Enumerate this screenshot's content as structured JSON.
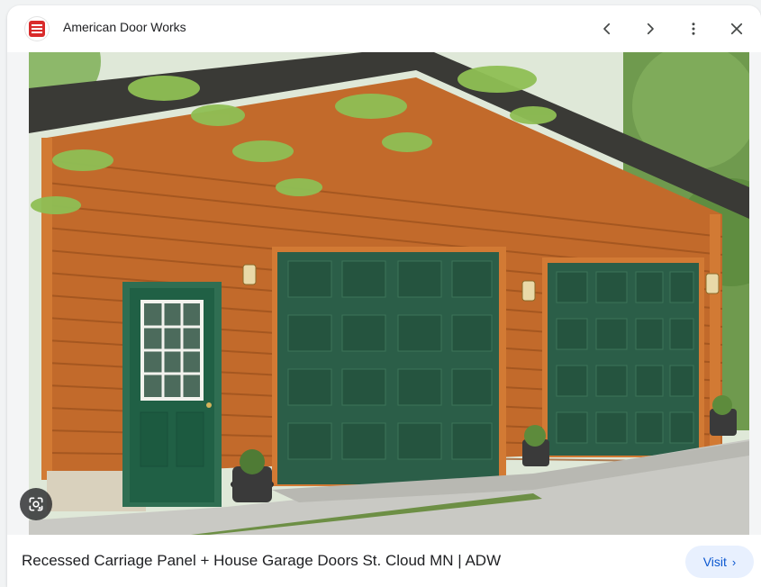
{
  "header": {
    "site_name": "American Door Works",
    "buttons": {
      "prev": "chevron-left-icon",
      "next": "chevron-right-icon",
      "more": "more-vert-icon",
      "close": "close-icon"
    }
  },
  "image": {
    "description_icon": "google-lens-icon"
  },
  "footer": {
    "caption": "Recessed Carriage Panel + House Garage Doors St. Cloud MN | ADW",
    "visit_label": "Visit",
    "visit_chevron": "›"
  },
  "colors": {
    "accent": "#0b57d0",
    "visit_bg": "#e8f0fe",
    "text": "#202124",
    "brand_red": "#d92b2b"
  }
}
